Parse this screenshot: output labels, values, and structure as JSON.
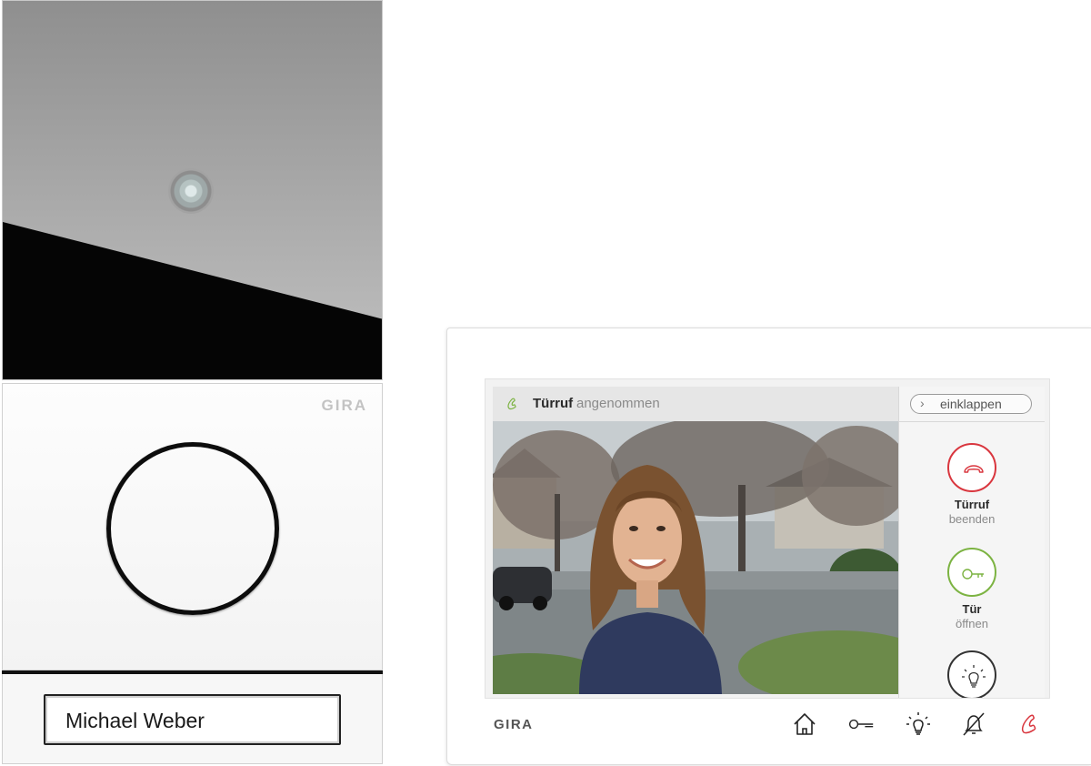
{
  "outdoor_station": {
    "brand": "GIRA",
    "nameplate": "Michael Weber"
  },
  "indoor_station": {
    "brand": "GIRA",
    "header": {
      "status_bold": "Türruf",
      "status_rest": "angenommen"
    },
    "collapse_button": {
      "label": "einklappen"
    },
    "actions": [
      {
        "line1": "Türruf",
        "line2": "beenden",
        "icon": "phone-hangup-icon",
        "color": "#d9363e"
      },
      {
        "line1": "Tür",
        "line2": "öffnen",
        "icon": "key-icon",
        "color": "#7cb342"
      },
      {
        "line1": "",
        "line2": "",
        "icon": "light-bulb-icon",
        "color": "#333333"
      }
    ],
    "nav_icons": [
      "home-icon",
      "key-icon",
      "light-icon",
      "mute-bell-icon",
      "phone-icon"
    ]
  },
  "colors": {
    "accent_red": "#d9363e",
    "accent_green": "#7cb342"
  }
}
